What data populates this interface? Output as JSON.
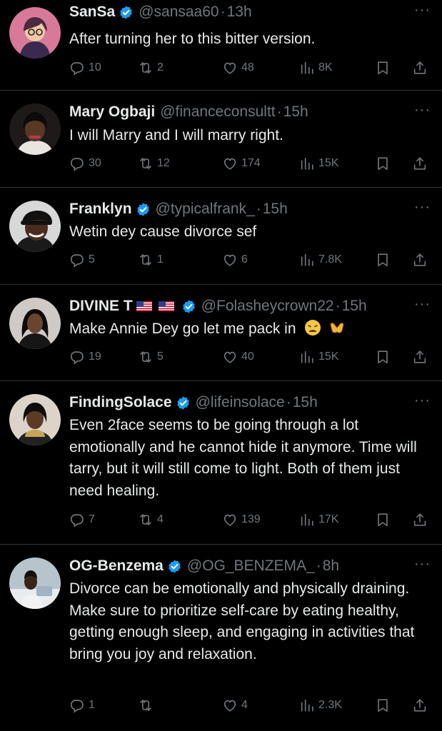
{
  "tweets": [
    {
      "name": "SanSa",
      "verified": true,
      "handle": "@sansaa60",
      "time": "13h",
      "text": "After turning her to this bitter version.",
      "replies": "10",
      "retweets": "2",
      "likes": "48",
      "views": "8K"
    },
    {
      "name": "Mary Ogbaji",
      "verified": false,
      "handle": "@financeconsultt",
      "time": "15h",
      "text": "I will Marry and I will marry right.",
      "replies": "30",
      "retweets": "12",
      "likes": "174",
      "views": "15K"
    },
    {
      "name": "Franklyn",
      "verified": true,
      "handle": "@typicalfrank_",
      "time": "15h",
      "text": "Wetin dey cause divorce sef",
      "replies": "5",
      "retweets": "1",
      "likes": "6",
      "views": "7.8K"
    },
    {
      "name": "DIVINE T",
      "verified": true,
      "handle": "@Folasheycrown22",
      "time": "15h",
      "text": "Make Annie Dey go let me pack in",
      "emojis": [
        "weary-face",
        "heart-hands"
      ],
      "replies": "19",
      "retweets": "5",
      "likes": "40",
      "views": "15K"
    },
    {
      "name": "FindingSolace",
      "verified": true,
      "handle": "@lifeinsolace",
      "time": "15h",
      "text": "Even 2face seems to be going through a lot emotionally and he cannot hide it anymore. Time will tarry, but it will still come to light. Both of them just need healing.",
      "replies": "7",
      "retweets": "4",
      "likes": "139",
      "views": "17K"
    },
    {
      "name": "OG-Benzema",
      "verified": true,
      "handle": "@OG_BENZEMA_",
      "time": "8h",
      "text": "Divorce can be emotionally and physically draining. Make sure to prioritize self-care by eating healthy, getting enough sleep, and engaging in activities that bring you joy and relaxation.",
      "replies": "1",
      "retweets": "",
      "likes": "4",
      "views": "2.3K"
    }
  ],
  "ui": {
    "more": "···",
    "separator": "·"
  },
  "colors": {
    "background": "#000000",
    "text": "#e7e9ea",
    "muted": "#71767b",
    "verified": "#1d9bf0",
    "divider": "#2f3336"
  }
}
